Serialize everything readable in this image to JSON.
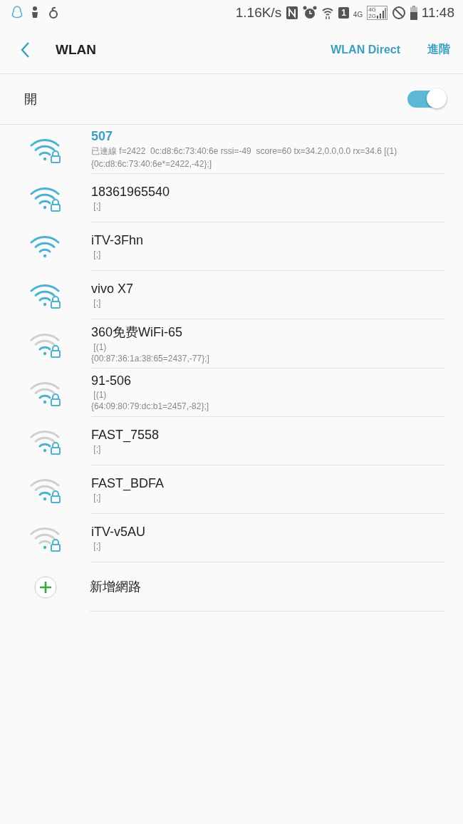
{
  "status_bar": {
    "speed": "1.16K/s",
    "sim": "1",
    "network": "4G",
    "signal_labels": [
      "4G",
      "2G"
    ],
    "time": "11:48"
  },
  "header": {
    "title": "WLAN",
    "actions": [
      "WLAN Direct",
      "進階"
    ]
  },
  "master_switch": {
    "label": "開",
    "on": true
  },
  "networks": [
    {
      "name": "507",
      "details": [
        "已連線 f=2422  0c:d8:6c:73:40:6e rssi=-49  score=60 tx=34.2,0.0,0.0 rx=34.6 [(1)",
        "{0c:d8:6c:73:40:6e*=2422,-42};]"
      ],
      "connected": true,
      "secured": true,
      "kind": "strong"
    },
    {
      "name": "18361965540",
      "details": [
        " [;]"
      ],
      "connected": false,
      "secured": true,
      "kind": "strong"
    },
    {
      "name": "iTV-3Fhn",
      "details": [
        " [;]"
      ],
      "connected": false,
      "secured": false,
      "kind": "strong"
    },
    {
      "name": "vivo X7",
      "details": [
        " [;]"
      ],
      "connected": false,
      "secured": true,
      "kind": "strong"
    },
    {
      "name": "360免费WiFi-65",
      "details": [
        " [(1)",
        "{00:87:36:1a:38:65=2437,-77};]"
      ],
      "connected": false,
      "secured": true,
      "kind": "fair"
    },
    {
      "name": "91-506",
      "details": [
        " [(1)",
        "{64:09:80:79:dc:b1=2457,-82};]"
      ],
      "connected": false,
      "secured": true,
      "kind": "fair"
    },
    {
      "name": "FAST_7558",
      "details": [
        " [;]"
      ],
      "connected": false,
      "secured": true,
      "kind": "fair"
    },
    {
      "name": "FAST_BDFA",
      "details": [
        " [;]"
      ],
      "connected": false,
      "secured": true,
      "kind": "fair"
    },
    {
      "name": "iTV-v5AU",
      "details": [
        " [;]"
      ],
      "connected": false,
      "secured": true,
      "kind": "weak"
    }
  ],
  "add_network": {
    "label": "新增網路"
  }
}
